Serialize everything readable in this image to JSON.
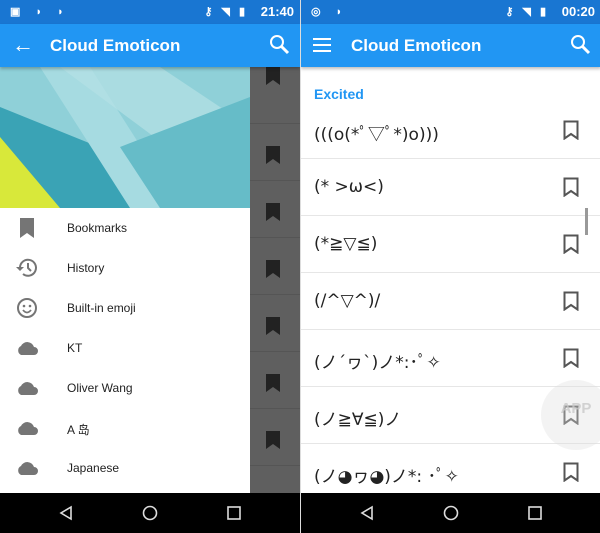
{
  "left": {
    "status": {
      "time": "21:40"
    },
    "toolbar": {
      "title": "Cloud Emoticon",
      "nav_icon": "arrow-back-icon",
      "action_icon": "search-icon"
    },
    "drawer": {
      "items": [
        {
          "label": "Bookmarks",
          "icon": "bookmark-icon"
        },
        {
          "label": "History",
          "icon": "history-icon"
        },
        {
          "label": "Built-in emoji",
          "icon": "smiley-icon"
        },
        {
          "label": "KT",
          "icon": "cloud-icon"
        },
        {
          "label": "Oliver Wang",
          "icon": "cloud-icon"
        },
        {
          "label": "A 岛",
          "icon": "cloud-icon"
        },
        {
          "label": "Japanese",
          "icon": "cloud-icon"
        }
      ]
    }
  },
  "right": {
    "status": {
      "time": "00:20"
    },
    "toolbar": {
      "title": "Cloud Emoticon",
      "nav_icon": "menu-icon",
      "action_icon": "search-icon"
    },
    "section": "Excited",
    "emoticons": [
      "(((o(*ﾟ▽ﾟ*)o)))",
      "(* >ω<)",
      "(*≧▽≦)",
      "(/^▽^)/",
      "(ノ´ヮ`)ノ*:･ﾟ✧",
      "(ノ≧∀≦)ノ",
      "(ノ◕ヮ◕)ノ*: ･ﾟ✧"
    ],
    "watermark": "APP solution"
  },
  "colors": {
    "primary": "#2196F3",
    "status": "#1976D2"
  }
}
